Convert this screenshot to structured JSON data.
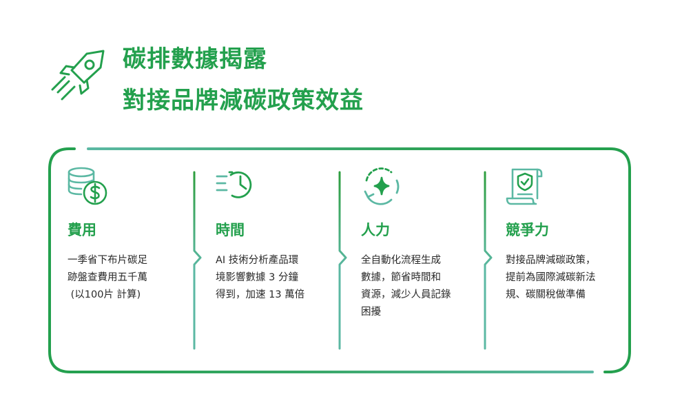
{
  "title": {
    "line1": "碳排數據揭露",
    "line2": "對接品牌減碳政策效益"
  },
  "colors": {
    "brand_green": "#23a04d",
    "teal": "#5bb8a3"
  },
  "icons": {
    "header": "rocket-icon",
    "cost": "coins-dollar-icon",
    "time": "fast-clock-icon",
    "manpower": "cycle-sparkle-icon",
    "competitiveness": "certificate-shield-icon"
  },
  "benefits": [
    {
      "heading": "費用",
      "lines": [
        "一季省下布片碳足",
        "跡盤查費用五千萬",
        " (以100片 計算)"
      ]
    },
    {
      "heading": "時間",
      "lines": [
        "AI 技術分析產品環",
        "境影響數據 3 分鐘",
        "得到，加速 13 萬倍"
      ]
    },
    {
      "heading": "人力",
      "lines": [
        "全自動化流程生成",
        "數據，節省時間和",
        "資源，減少人員記錄",
        "困擾"
      ]
    },
    {
      "heading": "競爭力",
      "lines": [
        "對接品牌減碳政策，",
        "提前為國際減碳新法",
        "規、碳關稅做準備"
      ]
    }
  ]
}
